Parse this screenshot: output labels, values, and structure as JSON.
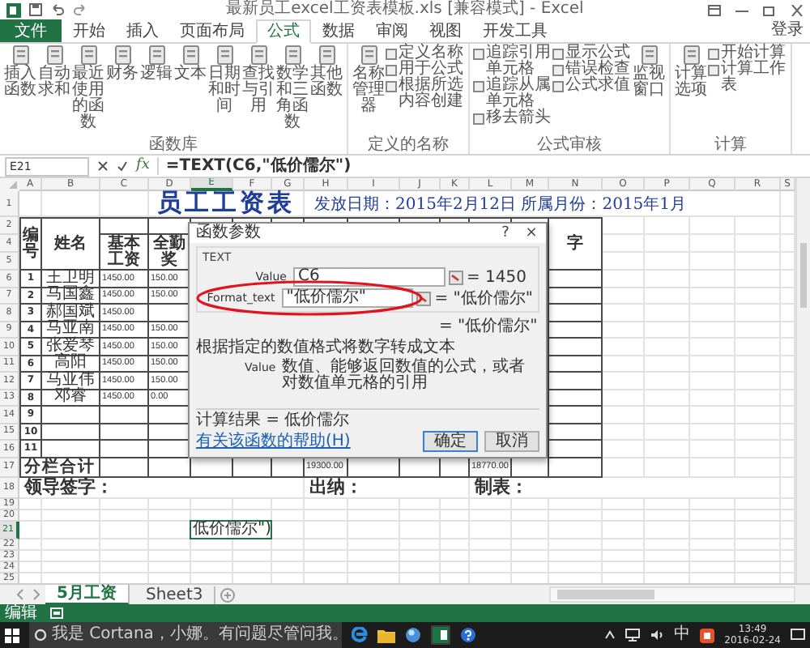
{
  "window": {
    "title": "最新员工excel工资表模板.xls [兼容模式] - Excel"
  },
  "ribbon_tabs": [
    {
      "label": "文件",
      "kind": "file",
      "selected": false
    },
    {
      "label": "开始",
      "kind": "tab",
      "selected": false
    },
    {
      "label": "插入",
      "kind": "tab",
      "selected": false
    },
    {
      "label": "页面布局",
      "kind": "tab",
      "selected": false
    },
    {
      "label": "公式",
      "kind": "tab",
      "selected": true
    },
    {
      "label": "数据",
      "kind": "tab",
      "selected": false
    },
    {
      "label": "审阅",
      "kind": "tab",
      "selected": false
    },
    {
      "label": "视图",
      "kind": "tab",
      "selected": false
    },
    {
      "label": "开发工具",
      "kind": "tab",
      "selected": false
    }
  ],
  "sign_in": "登录",
  "ribbon_groups": [
    {
      "label": "函数库",
      "buttons": [
        {
          "label": "插入函数",
          "kind": "large"
        },
        {
          "label": "自动求和",
          "kind": "large"
        },
        {
          "label": "最近使用的函数",
          "kind": "large"
        },
        {
          "label": "财务",
          "kind": "large"
        },
        {
          "label": "逻辑",
          "kind": "large"
        },
        {
          "label": "文本",
          "kind": "large"
        },
        {
          "label": "日期和时间",
          "kind": "large"
        },
        {
          "label": "查找与引用",
          "kind": "large"
        },
        {
          "label": "数学和三角函数",
          "kind": "large"
        },
        {
          "label": "其他函数",
          "kind": "large"
        }
      ]
    },
    {
      "label": "定义的名称",
      "buttons": [
        {
          "label": "名称管理器",
          "kind": "large"
        },
        {
          "label": "定义名称",
          "kind": "small"
        },
        {
          "label": "用于公式",
          "kind": "small"
        },
        {
          "label": "根据所选内容创建",
          "kind": "small"
        }
      ]
    },
    {
      "label": "公式审核",
      "buttons": [
        {
          "label": "追踪引用单元格",
          "kind": "small"
        },
        {
          "label": "追踪从属单元格",
          "kind": "small"
        },
        {
          "label": "移去箭头",
          "kind": "small"
        },
        {
          "label": "显示公式",
          "kind": "small"
        },
        {
          "label": "错误检查",
          "kind": "small"
        },
        {
          "label": "公式求值",
          "kind": "small"
        },
        {
          "label": "监视窗口",
          "kind": "large"
        }
      ]
    },
    {
      "label": "计算",
      "buttons": [
        {
          "label": "计算选项",
          "kind": "large"
        },
        {
          "label": "开始计算",
          "kind": "small"
        },
        {
          "label": "计算工作表",
          "kind": "small"
        }
      ]
    }
  ],
  "formula_bar": {
    "name_box": "E21",
    "fx": "fx",
    "formula": "=TEXT(C6,\"低价儒尔\")"
  },
  "sheet": {
    "columns": [
      "A",
      "B",
      "C",
      "D",
      "E",
      "F",
      "G",
      "H",
      "I",
      "J",
      "K",
      "L",
      "M",
      "N",
      "O",
      "P",
      "Q",
      "R",
      "S"
    ],
    "rows": [
      {
        "number": "1",
        "kind": "title",
        "cells": [
          "",
          "",
          "",
          "员工工资表",
          "",
          "",
          "",
          "发放日期：2015年2月12日  所属月份：2015年1月"
        ]
      },
      {
        "number": "2",
        "kind": "header",
        "cells": [
          "编号",
          "姓名",
          "",
          "",
          "",
          "",
          "",
          "",
          "",
          "",
          "",
          "",
          "",
          "字"
        ]
      },
      {
        "number": "4",
        "kind": "header",
        "cells": [
          "",
          "",
          "基本工资",
          "全勤奖"
        ]
      },
      {
        "number": "5",
        "kind": "header",
        "cells": []
      },
      {
        "number": "6",
        "kind": "data",
        "cells": [
          "1",
          "王卫明",
          "1450.00",
          "150.00"
        ]
      },
      {
        "number": "7",
        "kind": "data",
        "cells": [
          "2",
          "马国鑫",
          "1450.00",
          "150.00"
        ]
      },
      {
        "number": "8",
        "kind": "data",
        "cells": [
          "3",
          "郝国斌",
          "1450.00"
        ]
      },
      {
        "number": "9",
        "kind": "data",
        "cells": [
          "4",
          "马亚南",
          "1450.00",
          "150.00"
        ]
      },
      {
        "number": "10",
        "kind": "data",
        "cells": [
          "5",
          "张爱琴",
          "1450.00",
          "150.00"
        ]
      },
      {
        "number": "11",
        "kind": "data",
        "cells": [
          "6",
          "高阳",
          "1450.00",
          "150.00"
        ]
      },
      {
        "number": "12",
        "kind": "data",
        "cells": [
          "7",
          "马亚伟",
          "1450.00",
          "150.00"
        ]
      },
      {
        "number": "13",
        "kind": "data",
        "cells": [
          "8",
          "邓睿",
          "1450.00",
          "0.00"
        ]
      },
      {
        "number": "14",
        "kind": "data",
        "cells": [
          "9"
        ]
      },
      {
        "number": "15",
        "kind": "data",
        "cells": [
          "10"
        ]
      },
      {
        "number": "16",
        "kind": "data",
        "cells": [
          "11"
        ]
      },
      {
        "number": "17",
        "kind": "total",
        "cells": [
          "分栏合计",
          "",
          "",
          "",
          "",
          "",
          "",
          "19300.00",
          "",
          "",
          "",
          "18770.00"
        ]
      },
      {
        "number": "18",
        "kind": "sign",
        "cells": [
          "领导签字：",
          "",
          "",
          "",
          "",
          "",
          "",
          "出纳：",
          "",
          "",
          "",
          "制表："
        ]
      },
      {
        "number": "19",
        "kind": "blank",
        "cells": []
      },
      {
        "number": "20",
        "kind": "blank",
        "cells": []
      },
      {
        "number": "21",
        "kind": "cursor",
        "cells": [
          "",
          "",
          "",
          "",
          "低价儒尔\")"
        ]
      },
      {
        "number": "22",
        "kind": "blank",
        "cells": []
      },
      {
        "number": "23",
        "kind": "blank",
        "cells": []
      },
      {
        "number": "24",
        "kind": "blank",
        "cells": []
      },
      {
        "number": "25",
        "kind": "blank",
        "cells": []
      }
    ]
  },
  "dialog": {
    "title": "函数参数",
    "help": "?",
    "close": "×",
    "function": "TEXT",
    "args": [
      {
        "name": "Value",
        "value": "C6",
        "result": "= 1450"
      },
      {
        "name": "Format_text",
        "value": "\"低价儒尔\"",
        "result": "= \"低价儒尔\"",
        "circled": true
      }
    ],
    "result_line": "= \"低价儒尔\"",
    "description": "根据指定的数值格式将数字转成文本",
    "arg_help_name": "Value",
    "arg_help": "数值、能够返回数值的公式，或者对数值单元格的引用",
    "formula_result": "计算结果 =  低价儒尔",
    "help_link": "有关该函数的帮助(H)",
    "buttons": [
      {
        "label": "确定",
        "kind": "default"
      },
      {
        "label": "取消",
        "kind": "normal"
      }
    ]
  },
  "sheet_tabs": [
    {
      "label": "5月工资",
      "selected": true
    },
    {
      "label": "Sheet3",
      "selected": false
    }
  ],
  "status_bar": {
    "mode": "编辑"
  },
  "taskbar": {
    "search": "我是 Cortana，小娜。有问题尽管问我。",
    "ime": "中",
    "time": "13:49",
    "date": "2016-02-24"
  }
}
